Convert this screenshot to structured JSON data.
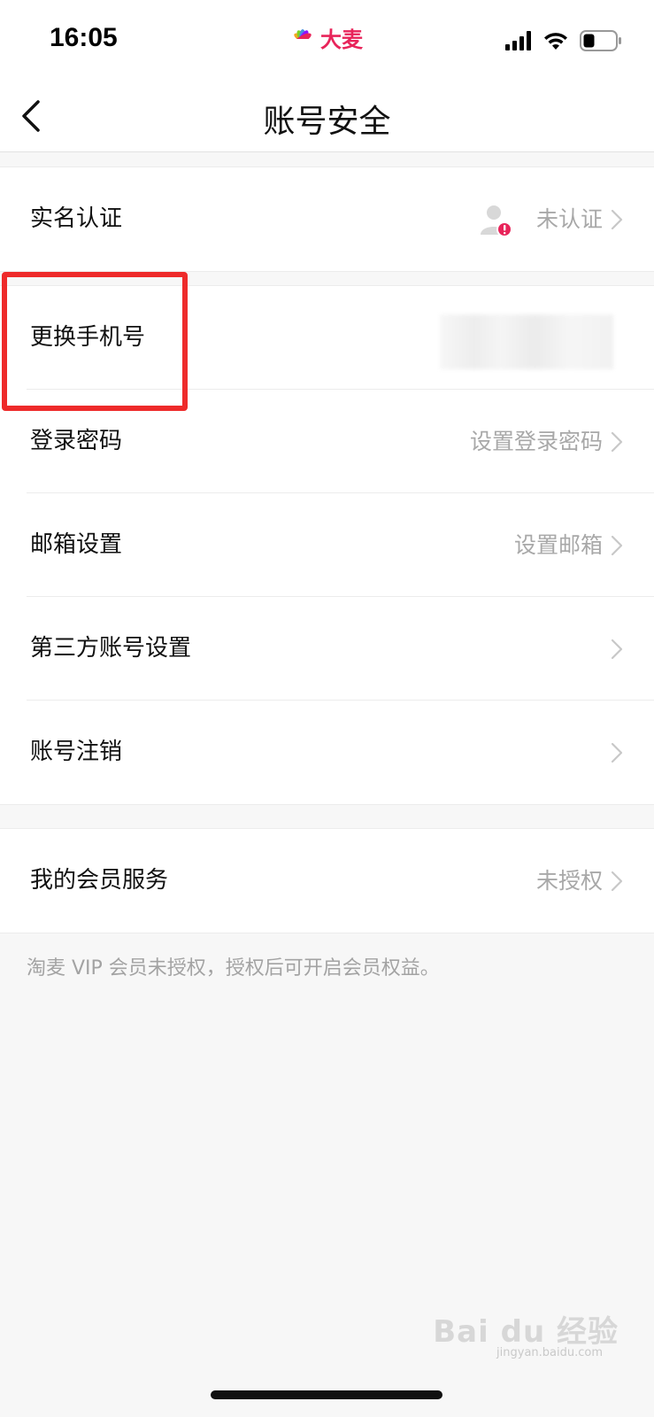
{
  "status_bar": {
    "time": "16:05",
    "app_logo_text": "大麦",
    "icons": [
      "signal-icon",
      "wifi-icon",
      "battery-icon"
    ]
  },
  "nav": {
    "title": "账号安全",
    "back_icon": "chevron-left-icon"
  },
  "rows": {
    "real_name": {
      "label": "实名认证",
      "value": "未认证"
    },
    "change_phone": {
      "label": "更换手机号",
      "value": ""
    },
    "login_password": {
      "label": "登录密码",
      "value": "设置登录密码"
    },
    "email": {
      "label": "邮箱设置",
      "value": "设置邮箱"
    },
    "third_party": {
      "label": "第三方账号设置",
      "value": ""
    },
    "cancel_account": {
      "label": "账号注销",
      "value": ""
    },
    "membership": {
      "label": "我的会员服务",
      "value": "未授权"
    }
  },
  "footnote": "淘麦 VIP 会员未授权，授权后可开启会员权益。",
  "watermark": {
    "text": "Bai du 经验",
    "sub": "jingyan.baidu.com"
  },
  "colors": {
    "accent_red": "#ee2a2a",
    "brand_pink": "#e8245a",
    "muted_text": "#a8a8a8"
  }
}
